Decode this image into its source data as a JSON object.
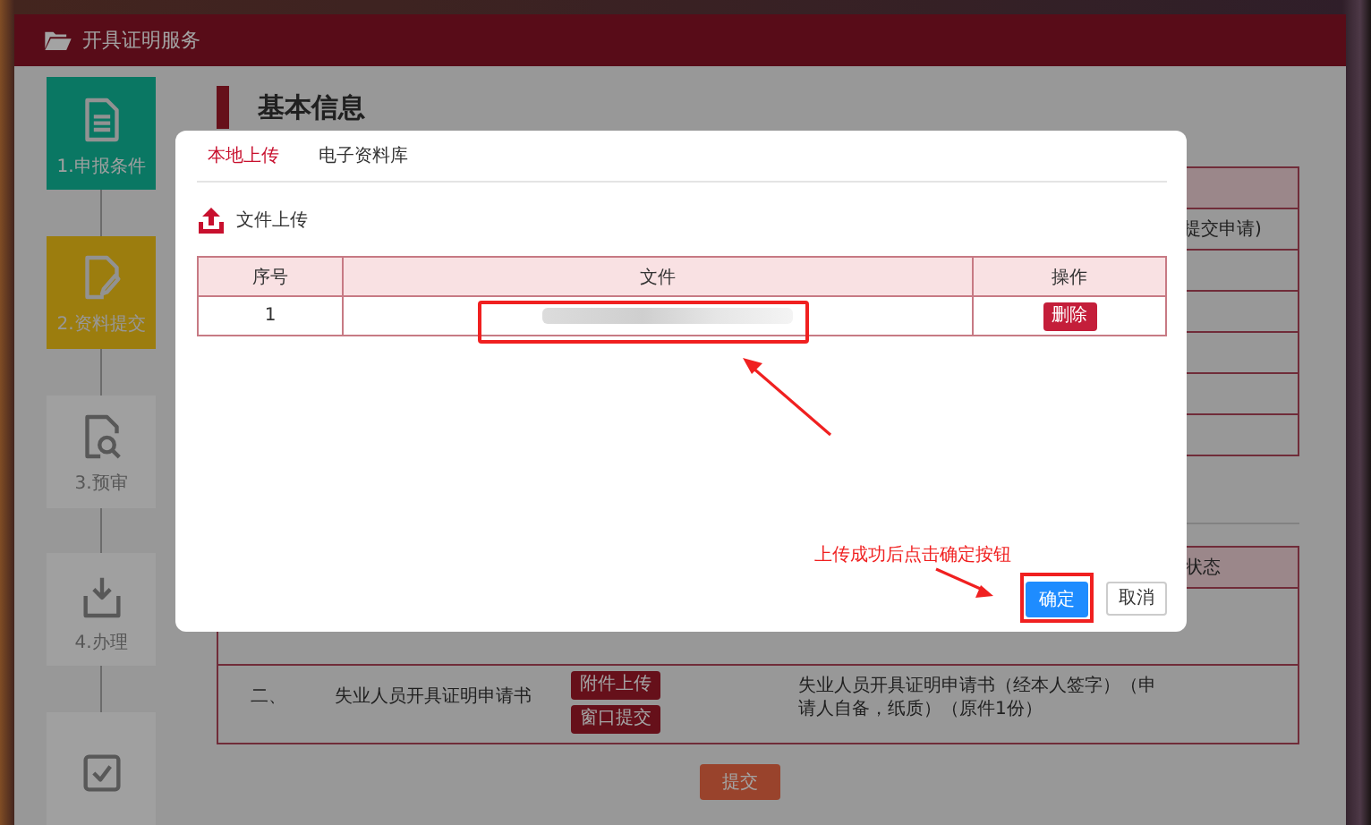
{
  "header": {
    "title": "开具证明服务"
  },
  "steps": [
    {
      "label": "1.申报条件",
      "completed": true,
      "selected": false,
      "kind": "document"
    },
    {
      "label": "2.资料提交",
      "completed": false,
      "selected": true,
      "kind": "edit"
    },
    {
      "label": "3.预审",
      "completed": false,
      "selected": false,
      "kind": "search"
    },
    {
      "label": "4.办理",
      "completed": false,
      "selected": false,
      "kind": "download"
    },
    {
      "completed": false,
      "selected": false,
      "kind": "check"
    }
  ],
  "section": {
    "title": "基本信息"
  },
  "info_table": {
    "visible_text": "提交申请)"
  },
  "materials_table": {
    "columns": [
      {
        "label": "状态"
      }
    ],
    "rows": [
      {
        "number": "二、",
        "name": "失业人员开具证明申请书",
        "buttons": [
          "附件上传",
          "窗口提交"
        ],
        "description": "失业人员开具证明申请书（经本人签字）（申请人自备，纸质）（原件1份）"
      }
    ]
  },
  "submit_button": "提交",
  "dialog": {
    "tabs": [
      {
        "label": "本地上传",
        "selected": true
      },
      {
        "label": "电子资料库",
        "selected": false
      }
    ],
    "upload_label": "文件上传",
    "table": {
      "columns": [
        "序号",
        "文件",
        "操作"
      ],
      "rows": [
        {
          "index": "1",
          "action": "删除"
        }
      ]
    },
    "buttons": [
      {
        "label": "确定",
        "kind": "primary"
      },
      {
        "label": "取消",
        "kind": "default"
      }
    ]
  },
  "annotation": {
    "instruction": "上传成功后点击确定按钮"
  }
}
